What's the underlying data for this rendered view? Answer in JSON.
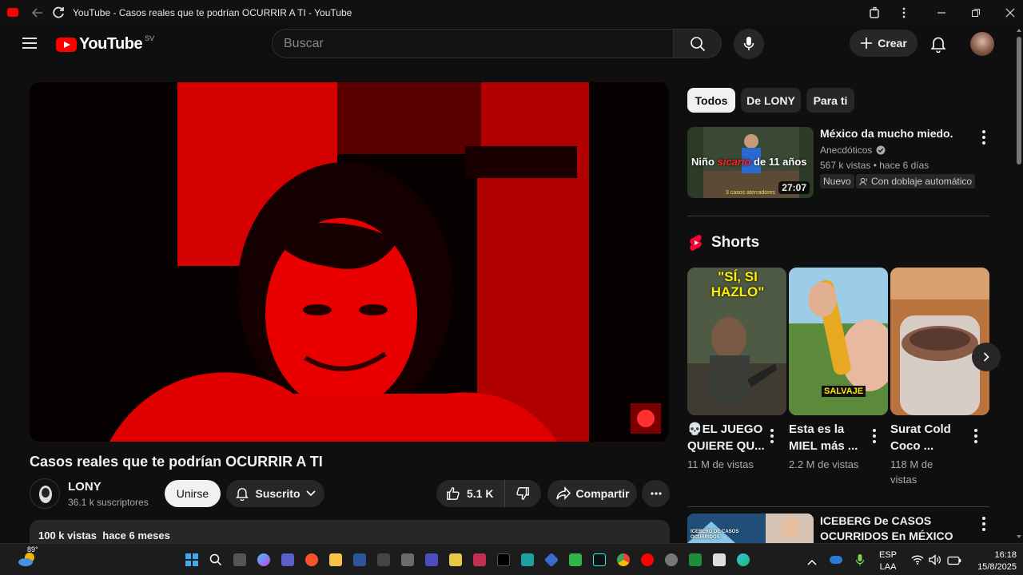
{
  "browser": {
    "tab_title": "YouTube - Casos reales que te podrían OCURRIR A TI - YouTube"
  },
  "header": {
    "logo_text": "YouTube",
    "country_code": "SV",
    "search_placeholder": "Buscar",
    "create_label": "Crear"
  },
  "video": {
    "title": "Casos reales que te podrían OCURRIR A TI",
    "channel_name": "LONY",
    "subscribers": "36.1 k suscriptores",
    "join_label": "Unirse",
    "subscribed_label": "Suscrito",
    "likes": "5.1 K",
    "share_label": "Compartir",
    "views": "100 k vistas",
    "published": "hace 6 meses"
  },
  "filters": [
    "Todos",
    "De LONY",
    "Para ti"
  ],
  "recommended": [
    {
      "title": "México da mucho miedo.",
      "channel": "Anecdóticos",
      "stats": "567 k vistas • hace 6 días",
      "badge_new": "Nuevo",
      "badge_dub": "Con doblaje automático",
      "duration": "27:07",
      "thumb_caption_a": "Niño ",
      "thumb_caption_b": "sicario",
      "thumb_caption_c": " de 11 años",
      "thumb_subtitle": "3 casos aterradores"
    },
    {
      "title": "ICEBERG De CASOS OCURRIDOS En MÉXICO",
      "thumb_text": "ICEBERG DE CASOS OCURRIDOS"
    }
  ],
  "shorts": {
    "heading": "Shorts",
    "items": [
      {
        "title": "💀EL JUEGO QUIERE QU...",
        "views": "11 M de vistas",
        "overlay": "\"SÍ, SI HAZLO\""
      },
      {
        "title": "Esta es la MIEL más ...",
        "views": "2.2 M de vistas",
        "overlay": "SALVAJE"
      },
      {
        "title": "Surat Cold Coco ...",
        "views": "118 M de vistas",
        "overlay": ""
      }
    ]
  },
  "taskbar": {
    "weather": "89°",
    "language": "ESP",
    "layout": "LAA",
    "time": "16:18",
    "date": "15/8/2025"
  },
  "colors": {
    "accent": "#ff0000",
    "background": "#0f0f0f",
    "surface": "#272727"
  }
}
